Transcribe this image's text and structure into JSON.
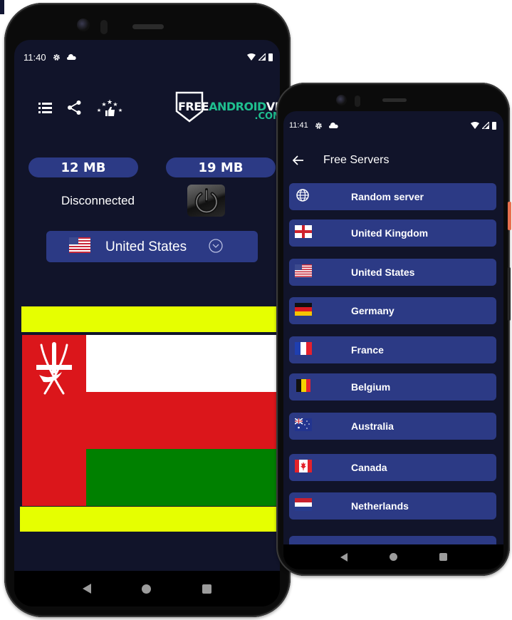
{
  "colors": {
    "screen_bg": "#11142a",
    "accent_blue": "#2c3a85",
    "brand_green": "#1fbf8f",
    "yellow": "#e6ff00"
  },
  "left_phone": {
    "status_bar": {
      "time": "11:40",
      "icons": [
        "gear-icon",
        "cloud-icon",
        "wifi-icon",
        "signal-icon",
        "battery-icon"
      ]
    },
    "toolbar": {
      "icons": [
        "menu-icon",
        "share-icon",
        "rate-icon"
      ]
    },
    "logo": {
      "part1": "FREE",
      "part2": "ANDROID",
      "part3": "VPN",
      "suffix": ".COM"
    },
    "stats": {
      "download": "12 MB",
      "upload": "19 MB"
    },
    "connection_status": "Disconnected",
    "power_button": {
      "icon": "power-icon"
    },
    "selected_server": {
      "country": "United States",
      "flag": "us-flag"
    },
    "displayed_flag": "Oman",
    "nav": [
      "back",
      "home",
      "recents"
    ]
  },
  "right_phone": {
    "status_bar": {
      "time": "11:41",
      "icons": [
        "gear-icon",
        "cloud-icon",
        "wifi-icon",
        "signal-icon",
        "battery-icon"
      ]
    },
    "header": {
      "title": "Free Servers",
      "back_icon": "arrow-left-icon"
    },
    "servers": [
      {
        "label": "Random server",
        "flag": "globe"
      },
      {
        "label": "United Kingdom",
        "flag": "gb"
      },
      {
        "label": "United States",
        "flag": "us"
      },
      {
        "label": "Germany",
        "flag": "de"
      },
      {
        "label": "France",
        "flag": "fr"
      },
      {
        "label": "Belgium",
        "flag": "be"
      },
      {
        "label": "Australia",
        "flag": "au"
      },
      {
        "label": "Canada",
        "flag": "ca"
      },
      {
        "label": "Netherlands",
        "flag": "nl"
      }
    ],
    "nav": [
      "back",
      "home",
      "recents"
    ]
  }
}
